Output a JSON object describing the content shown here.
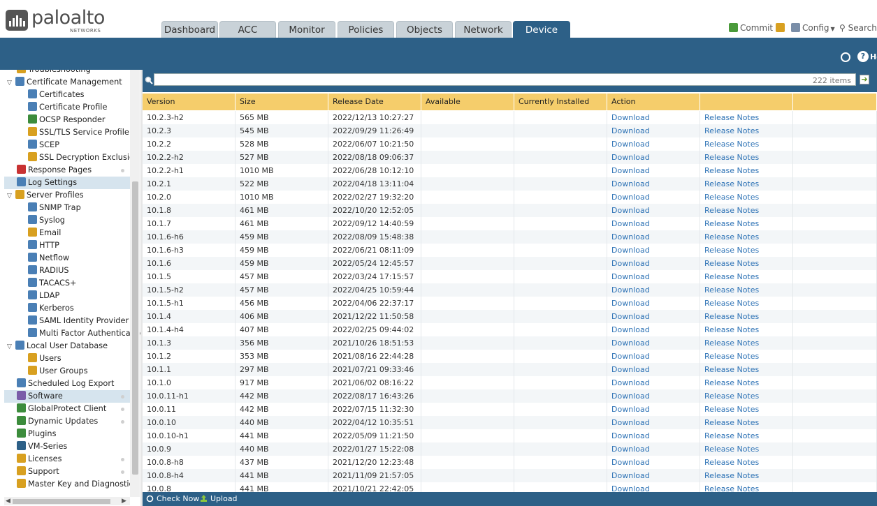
{
  "brand": {
    "name": "paloalto",
    "sub": "NETWORKS"
  },
  "tabs": [
    {
      "label": "Dashboard",
      "active": false
    },
    {
      "label": "ACC",
      "active": false
    },
    {
      "label": "Monitor",
      "active": false
    },
    {
      "label": "Policies",
      "active": false
    },
    {
      "label": "Objects",
      "active": false
    },
    {
      "label": "Network",
      "active": false
    },
    {
      "label": "Device",
      "active": true
    }
  ],
  "toplinks": {
    "commit": "Commit",
    "config": "Config",
    "search": "Search"
  },
  "toolbar": {
    "help": "He"
  },
  "sidebar": {
    "items": [
      {
        "label": "Troubleshooting",
        "indent": 1,
        "icon": "wrench-icon",
        "color": "#d8a020"
      },
      {
        "label": "Certificate Management",
        "indent": 0,
        "expand": true,
        "icon": "certificate-folder-icon",
        "color": "#4a7fb5"
      },
      {
        "label": "Certificates",
        "indent": 2,
        "icon": "certificate-icon",
        "color": "#4a7fb5"
      },
      {
        "label": "Certificate Profile",
        "indent": 2,
        "icon": "certificate-profile-icon",
        "color": "#4a7fb5"
      },
      {
        "label": "OCSP Responder",
        "indent": 2,
        "icon": "ocsp-icon",
        "color": "#3c8c3c"
      },
      {
        "label": "SSL/TLS Service Profile",
        "indent": 2,
        "icon": "lock-icon",
        "color": "#d8a020"
      },
      {
        "label": "SCEP",
        "indent": 2,
        "icon": "scep-icon",
        "color": "#4a7fb5"
      },
      {
        "label": "SSL Decryption Exclusion",
        "indent": 2,
        "icon": "lock-icon",
        "color": "#d8a020"
      },
      {
        "label": "Response Pages",
        "indent": 1,
        "icon": "no-entry-icon",
        "color": "#c83232",
        "dot": true
      },
      {
        "label": "Log Settings",
        "indent": 1,
        "icon": "log-settings-icon",
        "color": "#4a7fb5",
        "selected": true
      },
      {
        "label": "Server Profiles",
        "indent": 0,
        "expand": true,
        "icon": "server-profiles-icon",
        "color": "#d8a020"
      },
      {
        "label": "SNMP Trap",
        "indent": 2,
        "icon": "snmp-icon",
        "color": "#4a7fb5"
      },
      {
        "label": "Syslog",
        "indent": 2,
        "icon": "syslog-icon",
        "color": "#4a7fb5"
      },
      {
        "label": "Email",
        "indent": 2,
        "icon": "email-icon",
        "color": "#d8a020"
      },
      {
        "label": "HTTP",
        "indent": 2,
        "icon": "http-icon",
        "color": "#4a7fb5"
      },
      {
        "label": "Netflow",
        "indent": 2,
        "icon": "netflow-icon",
        "color": "#4a7fb5"
      },
      {
        "label": "RADIUS",
        "indent": 2,
        "icon": "radius-icon",
        "color": "#4a7fb5"
      },
      {
        "label": "TACACS+",
        "indent": 2,
        "icon": "tacacs-icon",
        "color": "#4a7fb5"
      },
      {
        "label": "LDAP",
        "indent": 2,
        "icon": "ldap-icon",
        "color": "#4a7fb5"
      },
      {
        "label": "Kerberos",
        "indent": 2,
        "icon": "kerberos-icon",
        "color": "#4a7fb5"
      },
      {
        "label": "SAML Identity Provider",
        "indent": 2,
        "icon": "saml-icon",
        "color": "#4a7fb5"
      },
      {
        "label": "Multi Factor Authentication",
        "indent": 2,
        "icon": "mfa-icon",
        "color": "#4a7fb5"
      },
      {
        "label": "Local User Database",
        "indent": 0,
        "expand": true,
        "icon": "user-database-icon",
        "color": "#4a7fb5"
      },
      {
        "label": "Users",
        "indent": 2,
        "icon": "user-icon",
        "color": "#d8a020"
      },
      {
        "label": "User Groups",
        "indent": 2,
        "icon": "user-group-icon",
        "color": "#d8a020"
      },
      {
        "label": "Scheduled Log Export",
        "indent": 1,
        "icon": "log-export-icon",
        "color": "#4a7fb5"
      },
      {
        "label": "Software",
        "indent": 1,
        "icon": "software-icon",
        "color": "#7a5ca8",
        "selected": true,
        "dot": true
      },
      {
        "label": "GlobalProtect Client",
        "indent": 1,
        "icon": "globe-icon",
        "color": "#3c8c3c",
        "dot": true
      },
      {
        "label": "Dynamic Updates",
        "indent": 1,
        "icon": "dynamic-updates-icon",
        "color": "#3c8c3c",
        "dot": true
      },
      {
        "label": "Plugins",
        "indent": 1,
        "icon": "plugin-icon",
        "color": "#3c8c3c"
      },
      {
        "label": "VM-Series",
        "indent": 1,
        "icon": "vm-series-icon",
        "color": "#2d6087"
      },
      {
        "label": "Licenses",
        "indent": 1,
        "icon": "key-icon",
        "color": "#d8a020",
        "dot": true
      },
      {
        "label": "Support",
        "indent": 1,
        "icon": "support-icon",
        "color": "#d8a020",
        "dot": true
      },
      {
        "label": "Master Key and Diagnostics",
        "indent": 1,
        "icon": "lock-icon",
        "color": "#d8a020"
      }
    ]
  },
  "search": {
    "placeholder": "",
    "count": "222 items"
  },
  "table": {
    "headers": [
      "Version",
      "Size",
      "Release Date",
      "Available",
      "Currently Installed",
      "Action",
      ""
    ],
    "rows": [
      [
        "10.2.3-h2",
        "565 MB",
        "2022/12/13 10:27:27",
        "",
        "",
        "Download",
        "Release Notes"
      ],
      [
        "10.2.3",
        "545 MB",
        "2022/09/29 11:26:49",
        "",
        "",
        "Download",
        "Release Notes"
      ],
      [
        "10.2.2",
        "528 MB",
        "2022/06/07 10:21:50",
        "",
        "",
        "Download",
        "Release Notes"
      ],
      [
        "10.2.2-h2",
        "527 MB",
        "2022/08/18 09:06:37",
        "",
        "",
        "Download",
        "Release Notes"
      ],
      [
        "10.2.2-h1",
        "1010 MB",
        "2022/06/28 10:12:10",
        "",
        "",
        "Download",
        "Release Notes"
      ],
      [
        "10.2.1",
        "522 MB",
        "2022/04/18 13:11:04",
        "",
        "",
        "Download",
        "Release Notes"
      ],
      [
        "10.2.0",
        "1010 MB",
        "2022/02/27 19:32:20",
        "",
        "",
        "Download",
        "Release Notes"
      ],
      [
        "10.1.8",
        "461 MB",
        "2022/10/20 12:52:05",
        "",
        "",
        "Download",
        "Release Notes"
      ],
      [
        "10.1.7",
        "461 MB",
        "2022/09/12 14:40:59",
        "",
        "",
        "Download",
        "Release Notes"
      ],
      [
        "10.1.6-h6",
        "459 MB",
        "2022/08/09 15:48:38",
        "",
        "",
        "Download",
        "Release Notes"
      ],
      [
        "10.1.6-h3",
        "459 MB",
        "2022/06/21 08:11:09",
        "",
        "",
        "Download",
        "Release Notes"
      ],
      [
        "10.1.6",
        "459 MB",
        "2022/05/24 12:45:57",
        "",
        "",
        "Download",
        "Release Notes"
      ],
      [
        "10.1.5",
        "457 MB",
        "2022/03/24 17:15:57",
        "",
        "",
        "Download",
        "Release Notes"
      ],
      [
        "10.1.5-h2",
        "457 MB",
        "2022/04/25 10:59:44",
        "",
        "",
        "Download",
        "Release Notes"
      ],
      [
        "10.1.5-h1",
        "456 MB",
        "2022/04/06 22:37:17",
        "",
        "",
        "Download",
        "Release Notes"
      ],
      [
        "10.1.4",
        "406 MB",
        "2021/12/22 11:50:58",
        "",
        "",
        "Download",
        "Release Notes"
      ],
      [
        "10.1.4-h4",
        "407 MB",
        "2022/02/25 09:44:02",
        "",
        "",
        "Download",
        "Release Notes"
      ],
      [
        "10.1.3",
        "356 MB",
        "2021/10/26 18:51:53",
        "",
        "",
        "Download",
        "Release Notes"
      ],
      [
        "10.1.2",
        "353 MB",
        "2021/08/16 22:44:28",
        "",
        "",
        "Download",
        "Release Notes"
      ],
      [
        "10.1.1",
        "297 MB",
        "2021/07/21 09:33:46",
        "",
        "",
        "Download",
        "Release Notes"
      ],
      [
        "10.1.0",
        "917 MB",
        "2021/06/02 08:16:22",
        "",
        "",
        "Download",
        "Release Notes"
      ],
      [
        "10.0.11-h1",
        "442 MB",
        "2022/08/17 16:43:26",
        "",
        "",
        "Download",
        "Release Notes"
      ],
      [
        "10.0.11",
        "442 MB",
        "2022/07/15 11:32:30",
        "",
        "",
        "Download",
        "Release Notes"
      ],
      [
        "10.0.10",
        "440 MB",
        "2022/04/12 10:35:51",
        "",
        "",
        "Download",
        "Release Notes"
      ],
      [
        "10.0.10-h1",
        "441 MB",
        "2022/05/09 11:21:50",
        "",
        "",
        "Download",
        "Release Notes"
      ],
      [
        "10.0.9",
        "440 MB",
        "2022/01/27 15:22:08",
        "",
        "",
        "Download",
        "Release Notes"
      ],
      [
        "10.0.8-h8",
        "437 MB",
        "2021/12/20 12:23:48",
        "",
        "",
        "Download",
        "Release Notes"
      ],
      [
        "10.0.8-h4",
        "441 MB",
        "2021/11/09 21:57:05",
        "",
        "",
        "Download",
        "Release Notes"
      ],
      [
        "10.0.8",
        "441 MB",
        "2021/10/21 22:42:05",
        "",
        "",
        "Download",
        "Release Notes"
      ]
    ]
  },
  "footer": {
    "check_now": "Check Now",
    "upload": "Upload"
  }
}
